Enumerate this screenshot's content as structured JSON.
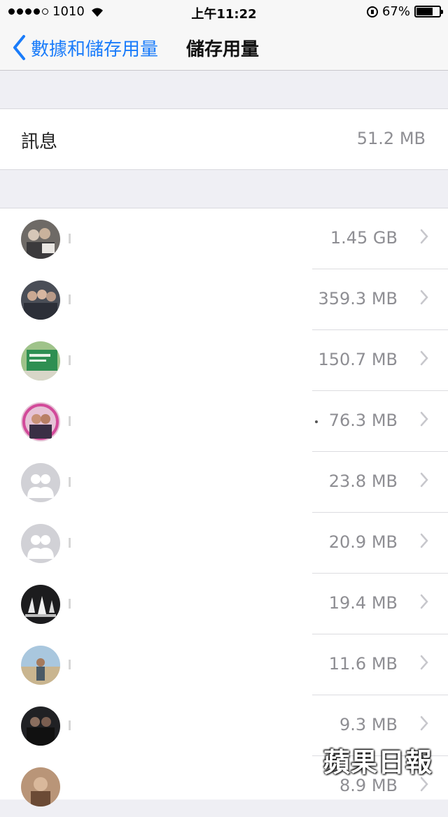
{
  "status_bar": {
    "carrier": "1010",
    "time": "上午11:22",
    "battery_percent": "67%",
    "battery_level": 0.67,
    "signal_dots_filled": 4,
    "signal_dots_total": 5
  },
  "nav": {
    "back_label": "數據和儲存用量",
    "title": "儲存用量"
  },
  "summary": {
    "label": "訊息",
    "value": "51.2 MB"
  },
  "conversations": [
    {
      "size": "1.45 GB",
      "avatar": "group-photo-avatar"
    },
    {
      "size": "359.3 MB",
      "avatar": "group-photo-avatar"
    },
    {
      "size": "150.7 MB",
      "avatar": "green-sign-photo-avatar"
    },
    {
      "size": "76.3 MB",
      "avatar": "couple-photo-avatar"
    },
    {
      "size": "23.8 MB",
      "avatar": "default-group-avatar"
    },
    {
      "size": "20.9 MB",
      "avatar": "default-group-avatar"
    },
    {
      "size": "19.4 MB",
      "avatar": "dark-photo-avatar"
    },
    {
      "size": "11.6 MB",
      "avatar": "beach-photo-avatar"
    },
    {
      "size": "9.3 MB",
      "avatar": "dark-group-photo-avatar"
    },
    {
      "size": "8.9 MB",
      "avatar": "photo-avatar"
    }
  ],
  "watermark": "蘋果日報",
  "colors": {
    "accent": "#1a7cfa",
    "secondary_text": "#8e8e93",
    "background": "#efeff4"
  }
}
